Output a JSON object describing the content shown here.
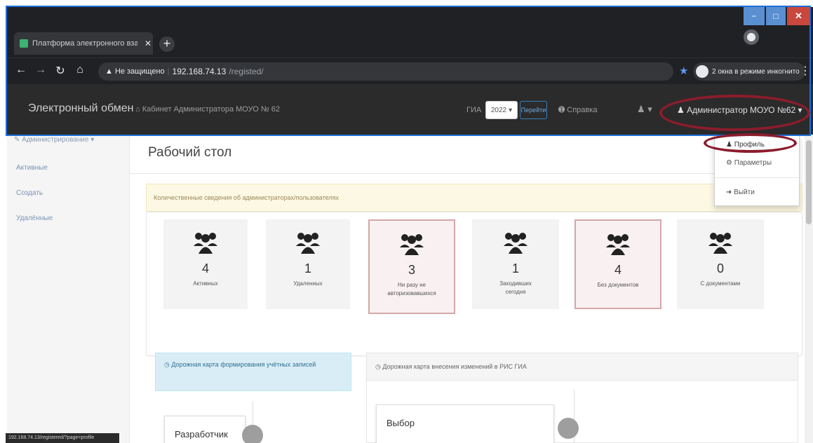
{
  "browser": {
    "tab_title": "Платформа электронного взаи",
    "tab_close": "✕",
    "new_tab": "+",
    "address_warning": "▲ Не защищено",
    "url_host": "192.168.74.13",
    "url_path": "/registed/",
    "incognito_label": "2 окна в режиме инкогнито",
    "status_url": "192.168.74.13/registered/?page=profile"
  },
  "navbar": {
    "brand": "Электронный обмен",
    "cabinet": "Кабинет Администратора МОУО № 62",
    "gia_label": "ГИА",
    "year_value": "2022",
    "go_button": "Перейти",
    "help": "Справка",
    "admin_menu": "Администратор МОУО №62"
  },
  "dropdown": {
    "profile": "Профиль",
    "params": "Параметры",
    "logout": "Выйти"
  },
  "sidebar": {
    "head": "Администрирование",
    "items": [
      "Активные",
      "Создать",
      "Удалённые"
    ]
  },
  "main": {
    "title": "Рабочий стол",
    "info_alert": "Количественные сведения об администраторах/пользователях"
  },
  "stats": [
    {
      "num": "4",
      "label": "Активных"
    },
    {
      "num": "1",
      "label": "Удаленных"
    },
    {
      "num": "3",
      "label": "Ни разу не авторизовавшихся"
    },
    {
      "num": "1",
      "label": "Заходивших сегодня"
    },
    {
      "num": "4",
      "label": "Без документов"
    },
    {
      "num": "0",
      "label": "С документами"
    }
  ],
  "roadmap": {
    "left_title": "Дорожная карта формирования учётных записей",
    "right_title": "Дорожная карта внесения изменений в РИС ГИА",
    "left_step": "Разработчик",
    "right_step": "Выбор"
  },
  "colors": {
    "highlight": "#8b1c2c",
    "accent": "#1e6fd9"
  }
}
